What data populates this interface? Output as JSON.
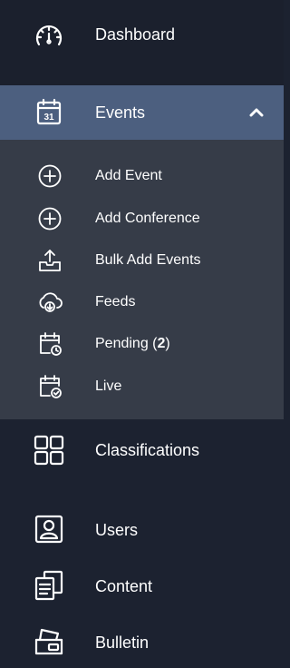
{
  "nav": {
    "dashboard": {
      "label": "Dashboard",
      "icon": "gauge-icon"
    },
    "events": {
      "label": "Events",
      "icon": "calendar-icon",
      "calendar_day": "31",
      "expanded": true,
      "caret_icon": "chevron-up-icon"
    },
    "events_submenu": {
      "add_event": {
        "label": "Add Event",
        "icon": "plus-circle-icon"
      },
      "add_conference": {
        "label": "Add Conference",
        "icon": "plus-circle-icon"
      },
      "bulk_add_events": {
        "label": "Bulk Add Events",
        "icon": "upload-tray-icon"
      },
      "feeds": {
        "label": "Feeds",
        "icon": "cloud-download-icon"
      },
      "pending": {
        "label": "Pending",
        "count_prefix": " (",
        "count": "2",
        "count_suffix": ")",
        "icon": "calendar-clock-icon"
      },
      "live": {
        "label": "Live",
        "icon": "calendar-check-icon"
      }
    },
    "classifications": {
      "label": "Classifications",
      "icon": "grid-icon"
    },
    "users": {
      "label": "Users",
      "icon": "user-icon"
    },
    "content": {
      "label": "Content",
      "icon": "documents-icon"
    },
    "bulletin": {
      "label": "Bulletin",
      "icon": "card-holder-icon"
    }
  },
  "colors": {
    "sidebar_bg": "#1c2230",
    "active_bg": "#4c5f7f",
    "submenu_bg": "#363c48",
    "text": "#ffffff"
  }
}
